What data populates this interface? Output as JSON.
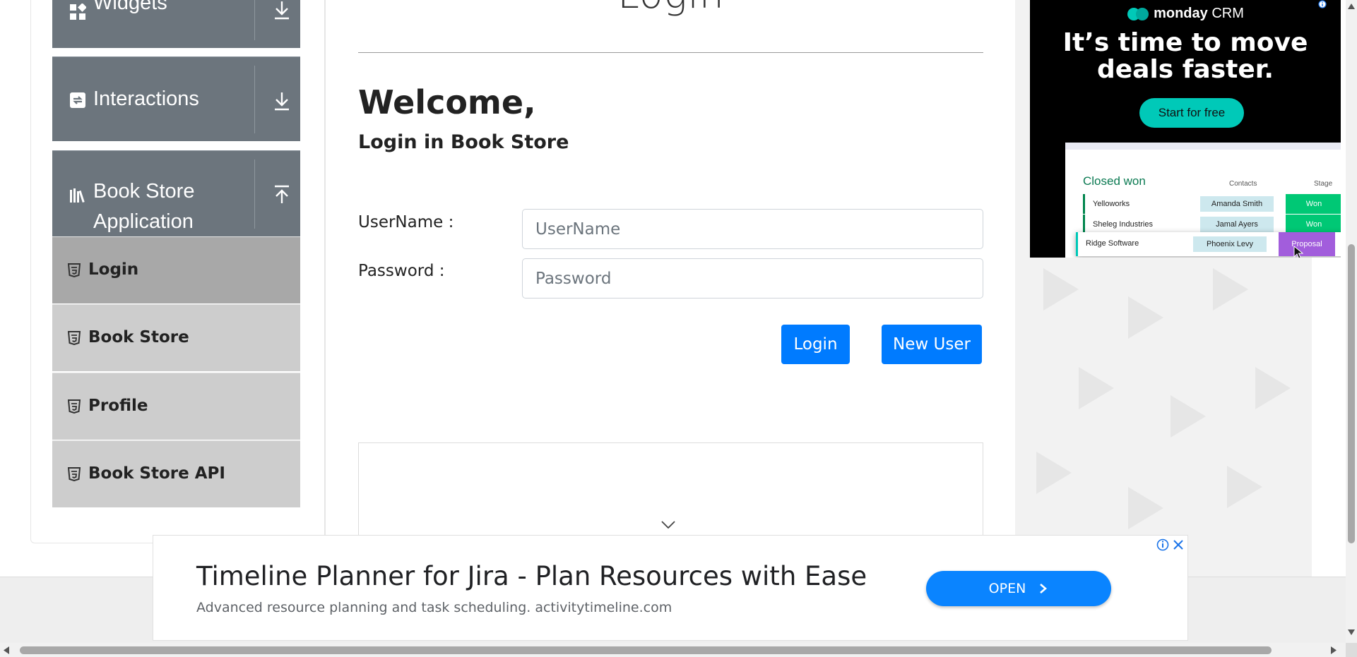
{
  "sidebar": {
    "groups": [
      {
        "label": "Widgets",
        "icon": "widgets-icon",
        "toggle": "download-arrow-icon"
      },
      {
        "label": "Interactions",
        "icon": "interactions-icon",
        "toggle": "download-arrow-icon"
      },
      {
        "label_line1": "Book Store",
        "label_line2": "Application",
        "icon": "books-icon",
        "toggle": "upload-arrow-icon"
      }
    ],
    "items": [
      {
        "label": "Login",
        "active": true
      },
      {
        "label": "Book Store",
        "active": false
      },
      {
        "label": "Profile",
        "active": false
      },
      {
        "label": "Book Store API",
        "active": false
      }
    ]
  },
  "main": {
    "page_title": "Login",
    "welcome": "Welcome,",
    "subheading": "Login in Book Store",
    "username_label": "UserName :",
    "username_placeholder": "UserName",
    "username_value": "",
    "password_label": "Password :",
    "password_placeholder": "Password",
    "password_value": "",
    "login_button": "Login",
    "new_user_button": "New User"
  },
  "right_ad": {
    "brand_bold": "monday",
    "brand_rest": " CRM",
    "headline_line1": "It’s time to move",
    "headline_line2": "deals faster.",
    "cta": "Start for free",
    "board_title": "Closed won",
    "col_contacts": "Contacts",
    "col_stage": "Stage",
    "rows": [
      {
        "company": "Yelloworks",
        "contact": "Amanda Smith",
        "stage": "Won"
      },
      {
        "company": "Sheleg Industries",
        "contact": "Jamal Ayers",
        "stage": "Won"
      },
      {
        "company": "Ridge Software",
        "contact": "Phoenix Levy",
        "stage": "Proposal"
      }
    ]
  },
  "bottom_ad": {
    "title": "Timeline Planner for Jira - Plan Resources with Ease",
    "description": "Advanced resource planning and task scheduling. activitytimeline.com",
    "open_button": "OPEN"
  },
  "colors": {
    "primary": "#007bff",
    "sidebar_group": "#6c757d",
    "sidebar_item": "#cdcdcd",
    "sidebar_item_active": "#a8a8a8"
  }
}
